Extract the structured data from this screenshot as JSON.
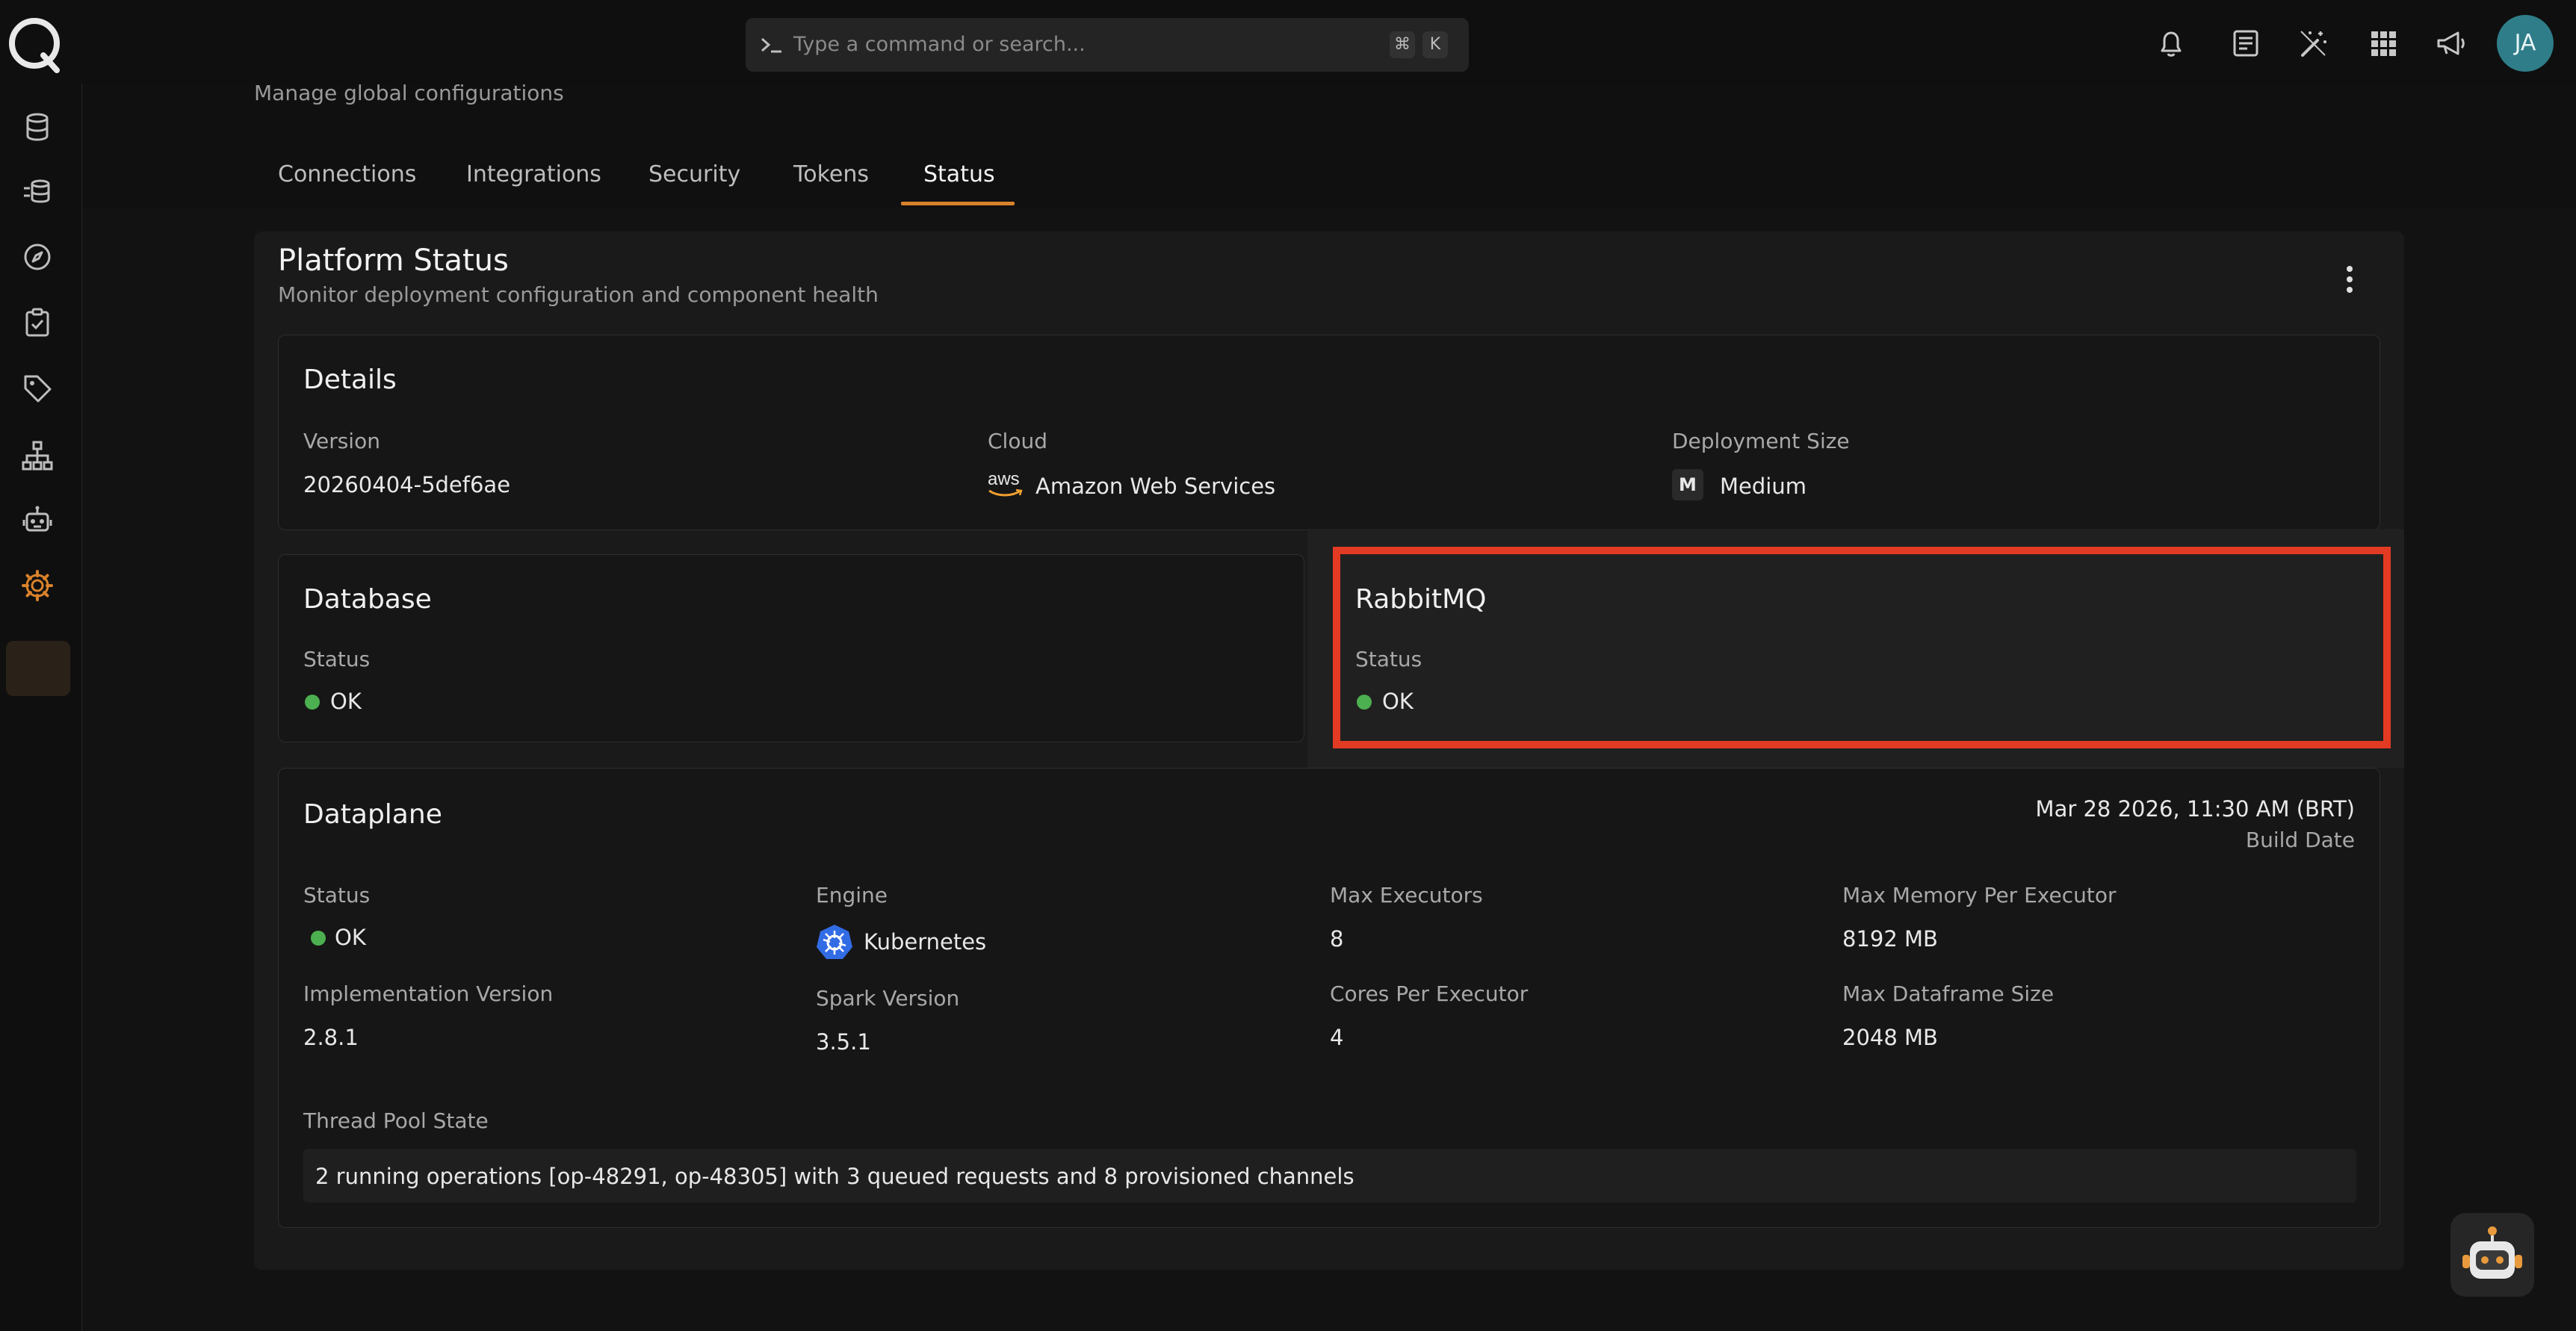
{
  "search": {
    "placeholder": "Type a command or search...",
    "shortcut_key_1": "⌘",
    "shortcut_key_2": "K"
  },
  "user": {
    "initials": "JA"
  },
  "top_icons": [
    "bell-icon",
    "document-icon",
    "magic-wand-icon",
    "apps-grid-icon",
    "megaphone-icon"
  ],
  "sidebar": {
    "items": [
      "database-icon",
      "data-stack-icon",
      "compass-icon",
      "clipboard-check-icon",
      "tag-icon",
      "hierarchy-icon",
      "robot-icon",
      "gear-icon"
    ],
    "active": "gear-icon"
  },
  "header": {
    "subtitle": "Manage global configurations",
    "tabs": [
      {
        "label": "Connections"
      },
      {
        "label": "Integrations"
      },
      {
        "label": "Security"
      },
      {
        "label": "Tokens"
      },
      {
        "label": "Status"
      }
    ],
    "active_tab": "Status"
  },
  "card": {
    "title": "Platform Status",
    "subtitle": "Monitor deployment configuration and component health"
  },
  "details": {
    "title": "Details",
    "version_label": "Version",
    "version_value": "20260404-5def6ae",
    "cloud_label": "Cloud",
    "cloud_icon_text": "aws",
    "cloud_value": "Amazon Web Services",
    "size_label": "Deployment Size",
    "size_badge": "M",
    "size_value": "Medium"
  },
  "database": {
    "title": "Database",
    "status_label": "Status",
    "status_value": "OK"
  },
  "rabbitmq": {
    "title": "RabbitMQ",
    "status_label": "Status",
    "status_value": "OK"
  },
  "dataplane": {
    "title": "Dataplane",
    "build_date_value": "Mar 28 2026, 11:30 AM (BRT)",
    "build_date_label": "Build Date",
    "status_label": "Status",
    "status_value": "OK",
    "engine_label": "Engine",
    "engine_value": "Kubernetes",
    "max_executors_label": "Max Executors",
    "max_executors_value": "8",
    "max_memory_label": "Max Memory Per Executor",
    "max_memory_value": "8192 MB",
    "impl_version_label": "Implementation Version",
    "impl_version_value": "2.8.1",
    "spark_version_label": "Spark Version",
    "spark_version_value": "3.5.1",
    "cores_label": "Cores Per Executor",
    "cores_value": "4",
    "max_df_label": "Max Dataframe Size",
    "max_df_value": "2048 MB",
    "thread_pool_label": "Thread Pool State",
    "thread_pool_value": "2 running operations [op-48291, op-48305] with 3 queued requests and 8 provisioned channels"
  },
  "colors": {
    "accent": "#d9822b",
    "ok": "#4caf50",
    "highlight": "#e23a23",
    "avatar": "#2f7d89"
  }
}
